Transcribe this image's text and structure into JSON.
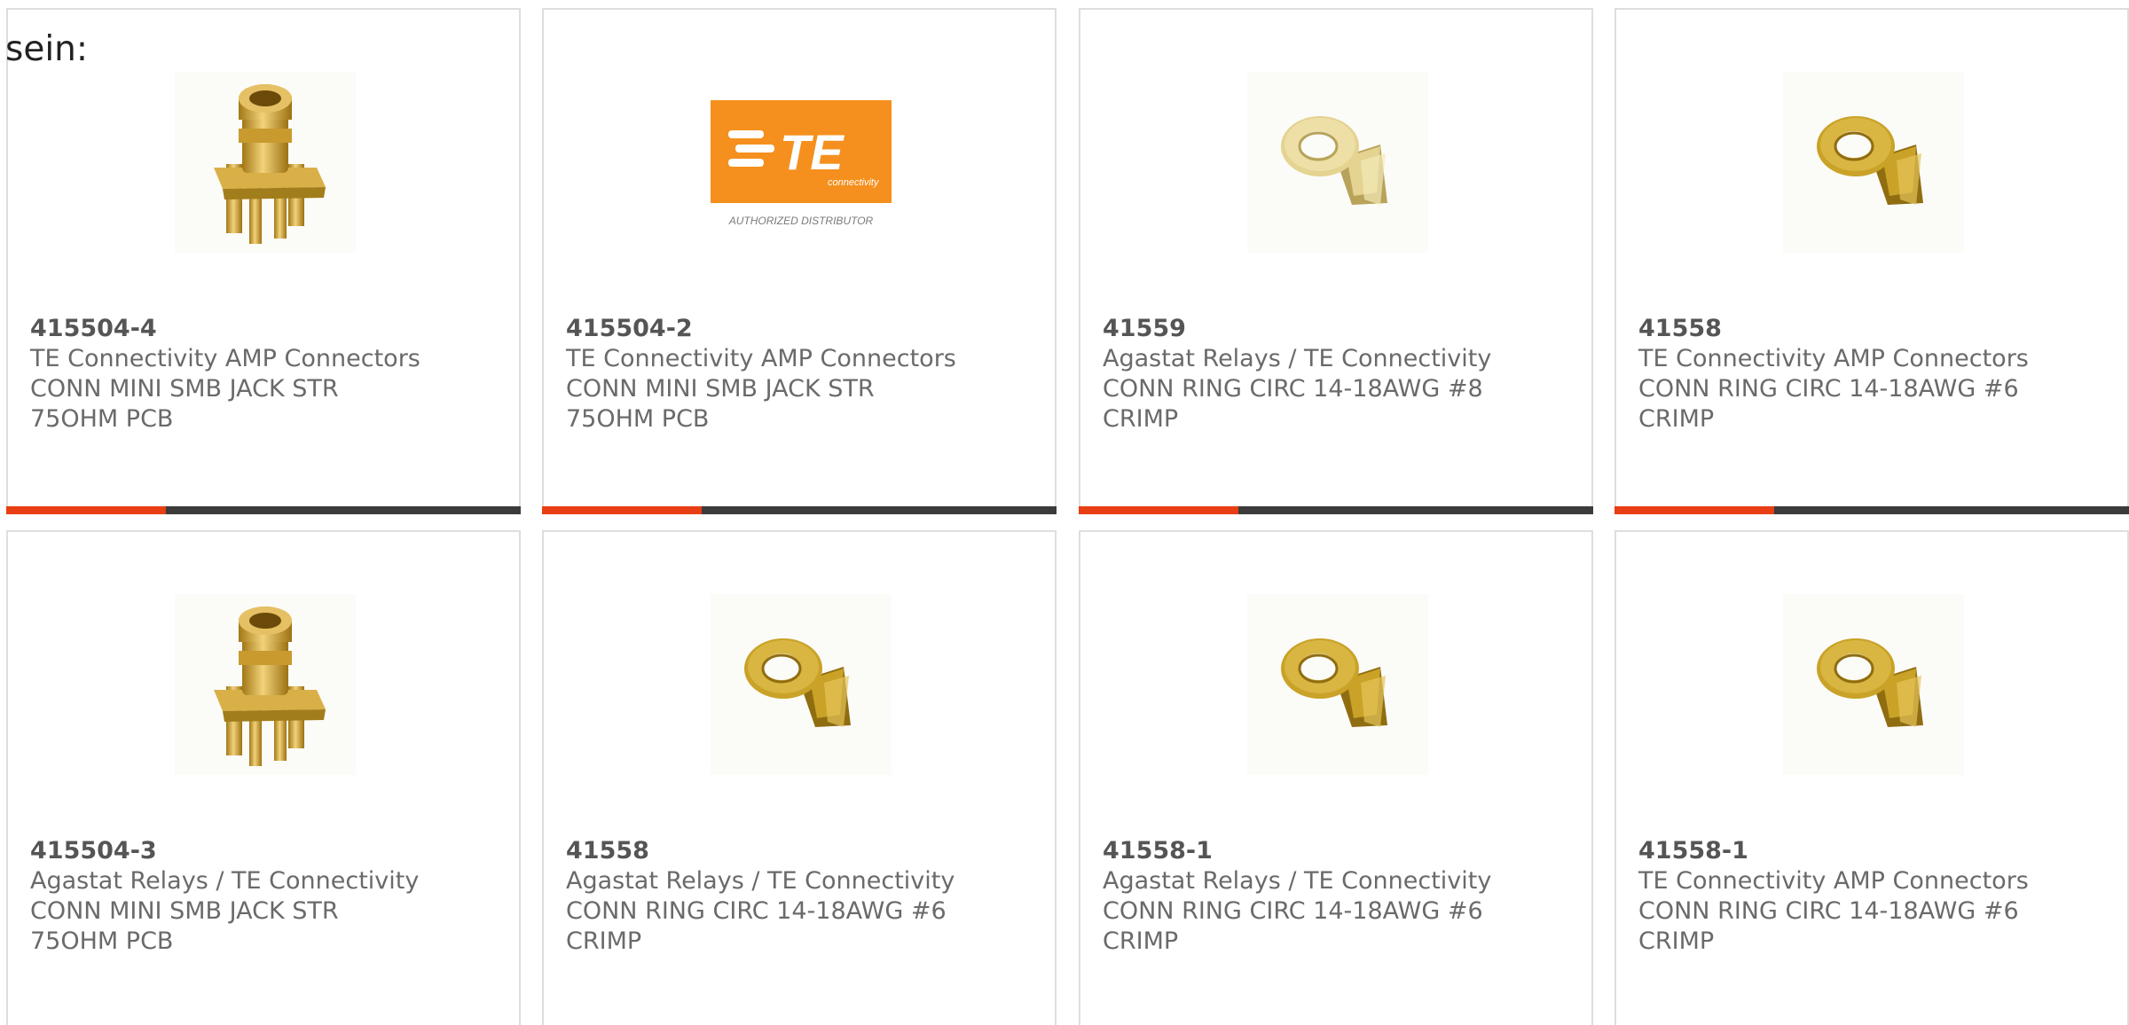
{
  "intro_text": "sein:",
  "colors": {
    "accent": "#e83e13",
    "track": "#3b3b3b",
    "te_orange": "#f5901e",
    "gold": "#c9a227"
  },
  "te_logo": {
    "text": "TE",
    "subtext": "connectivity",
    "caption": "AUTHORIZED DISTRIBUTOR"
  },
  "products": [
    {
      "part": "415504-4",
      "maker": "TE Connectivity AMP Connectors",
      "desc1": "CONN MINI SMB JACK STR",
      "desc2": "75OHM PCB",
      "image": "smb-jack-connector",
      "progress": 0.31
    },
    {
      "part": "415504-2",
      "maker": "TE Connectivity AMP Connectors",
      "desc1": "CONN MINI SMB JACK STR",
      "desc2": "75OHM PCB",
      "image": "te-logo",
      "progress": 0.31
    },
    {
      "part": "41559",
      "maker": "Agastat Relays / TE Connectivity",
      "desc1": "CONN RING CIRC 14-18AWG #8",
      "desc2": "CRIMP",
      "image": "ring-terminal-light",
      "progress": 0.31
    },
    {
      "part": "41558",
      "maker": "TE Connectivity AMP Connectors",
      "desc1": "CONN RING CIRC 14-18AWG #6",
      "desc2": "CRIMP",
      "image": "ring-terminal",
      "progress": 0.31
    },
    {
      "part": "415504-3",
      "maker": "Agastat Relays / TE Connectivity",
      "desc1": "CONN MINI SMB JACK STR",
      "desc2": "75OHM PCB",
      "image": "smb-jack-connector",
      "progress": 0
    },
    {
      "part": "41558",
      "maker": "Agastat Relays / TE Connectivity",
      "desc1": "CONN RING CIRC 14-18AWG #6",
      "desc2": "CRIMP",
      "image": "ring-terminal",
      "progress": 0
    },
    {
      "part": "41558-1",
      "maker": "Agastat Relays / TE Connectivity",
      "desc1": "CONN RING CIRC 14-18AWG #6",
      "desc2": "CRIMP",
      "image": "ring-terminal",
      "progress": 0
    },
    {
      "part": "41558-1",
      "maker": "TE Connectivity AMP Connectors",
      "desc1": "CONN RING CIRC 14-18AWG #6",
      "desc2": "CRIMP",
      "image": "ring-terminal",
      "progress": 0
    }
  ]
}
